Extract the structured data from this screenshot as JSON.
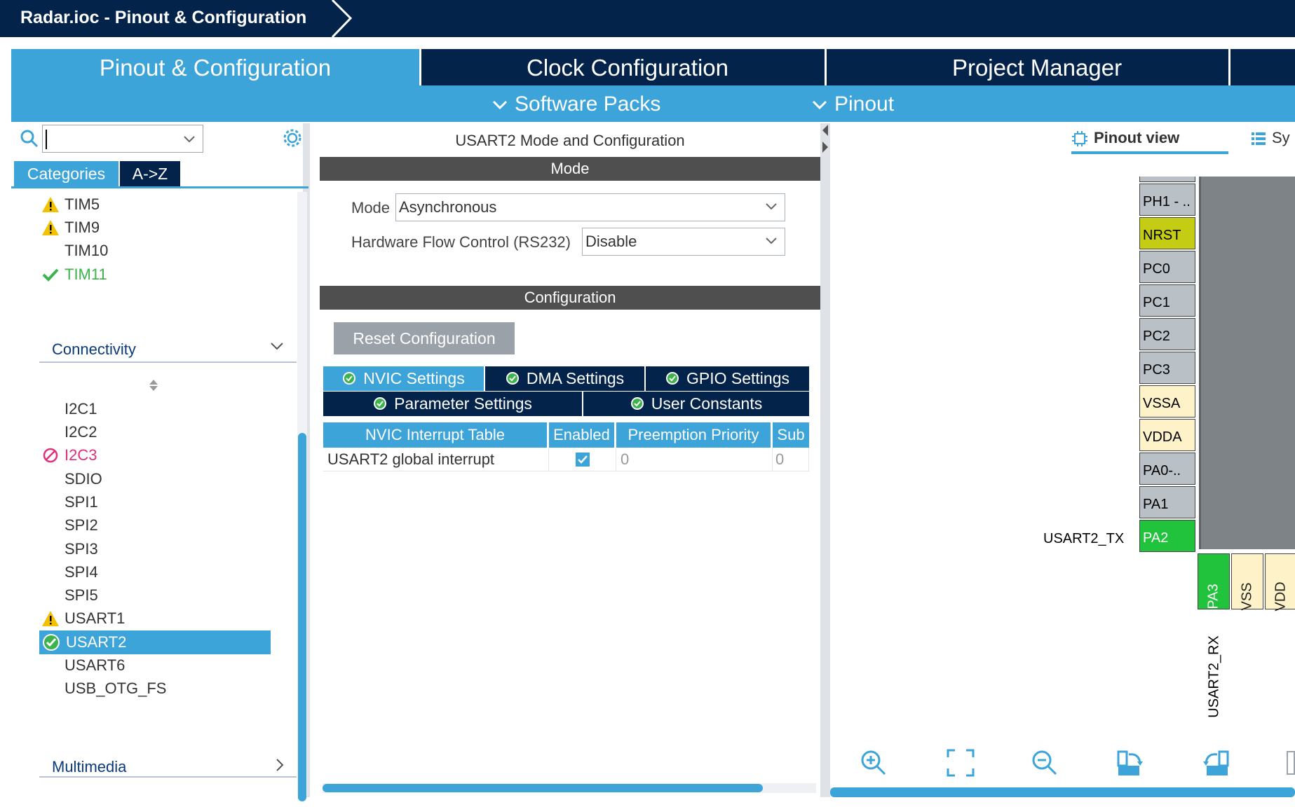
{
  "window": {
    "title": "Radar.ioc - Pinout & Configuration"
  },
  "tabs": {
    "pinout": "Pinout & Configuration",
    "clock": "Clock Configuration",
    "project": "Project Manager"
  },
  "subbar": {
    "software_packs": "Software Packs",
    "pinout": "Pinout"
  },
  "left": {
    "search_value": "",
    "categories_btn": "Categories",
    "az_btn": "A->Z",
    "timers": [
      {
        "label": "TIM5",
        "status": "warning"
      },
      {
        "label": "TIM9",
        "status": "warning"
      },
      {
        "label": "TIM10",
        "status": "none"
      },
      {
        "label": "TIM11",
        "status": "ok"
      }
    ],
    "connectivity_group": "Connectivity",
    "connectivity": [
      {
        "label": "I2C1",
        "status": "none"
      },
      {
        "label": "I2C2",
        "status": "none"
      },
      {
        "label": "I2C3",
        "status": "blocked"
      },
      {
        "label": "SDIO",
        "status": "none"
      },
      {
        "label": "SPI1",
        "status": "none"
      },
      {
        "label": "SPI2",
        "status": "none"
      },
      {
        "label": "SPI3",
        "status": "none"
      },
      {
        "label": "SPI4",
        "status": "none"
      },
      {
        "label": "SPI5",
        "status": "none"
      },
      {
        "label": "USART1",
        "status": "warning"
      },
      {
        "label": "USART2",
        "status": "selected-ok"
      },
      {
        "label": "USART6",
        "status": "none"
      },
      {
        "label": "USB_OTG_FS",
        "status": "none"
      }
    ],
    "multimedia_group": "Multimedia"
  },
  "middle": {
    "title": "USART2 Mode and Configuration",
    "mode_section": "Mode",
    "mode_label": "Mode",
    "mode_value": "Asynchronous",
    "hwflow_label": "Hardware Flow Control (RS232)",
    "hwflow_value": "Disable",
    "config_section": "Configuration",
    "reset_btn": "Reset Configuration",
    "settings_tabs": {
      "nvic": "NVIC Settings",
      "dma": "DMA Settings",
      "gpio": "GPIO Settings",
      "param": "Parameter Settings",
      "user": "User Constants"
    },
    "table": {
      "headers": [
        "NVIC Interrupt Table",
        "Enabled",
        "Preemption Priority",
        "Sub"
      ],
      "rows": [
        {
          "name": "USART2 global interrupt",
          "enabled": true,
          "preemption": "0",
          "sub": "0"
        }
      ]
    }
  },
  "right": {
    "pinout_view": "Pinout view",
    "system_view": "Sy",
    "pins": [
      {
        "label": "PH1 - ..",
        "color": "#b9c0c6"
      },
      {
        "label": "NRST",
        "color": "#c4cc14"
      },
      {
        "label": "PC0",
        "color": "#b9c0c6"
      },
      {
        "label": "PC1",
        "color": "#b9c0c6"
      },
      {
        "label": "PC2",
        "color": "#b9c0c6"
      },
      {
        "label": "PC3",
        "color": "#b9c0c6"
      },
      {
        "label": "VSSA",
        "color": "#fdf2c8"
      },
      {
        "label": "VDDA",
        "color": "#fdf2c8"
      },
      {
        "label": "PA0-..",
        "color": "#b9c0c6"
      },
      {
        "label": "PA1",
        "color": "#b9c0c6"
      },
      {
        "label": "PA2",
        "color": "#22c33c"
      }
    ],
    "signal_tx": "USART2_TX",
    "bottom_pins": [
      {
        "label": "PA3",
        "color": "#22c33c"
      },
      {
        "label": "VSS",
        "color": "#fdf2c8"
      },
      {
        "label": "VDD",
        "color": "#fdf2c8"
      }
    ],
    "signal_rx": "USART2_RX"
  },
  "colors": {
    "navy": "#03234b",
    "accent": "#3ca4d9",
    "section": "#4f4f4f",
    "warning": "#f2c200",
    "ok": "#3cb44b",
    "blocked": "#e0307a"
  }
}
